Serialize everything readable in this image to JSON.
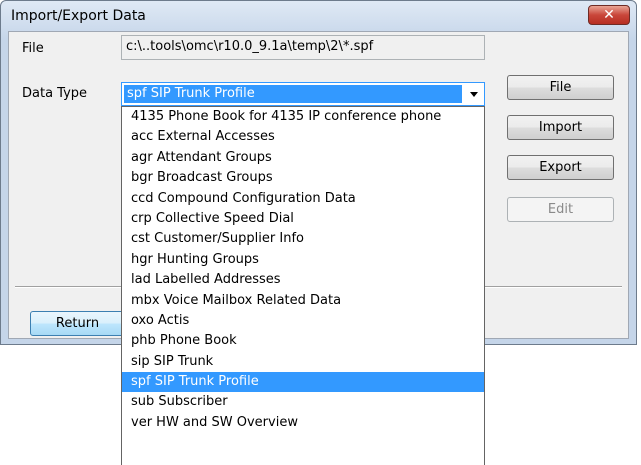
{
  "window": {
    "title": "Import/Export Data",
    "close_glyph": "✕"
  },
  "form": {
    "file_label": "File",
    "file_value": "c:\\..tools\\omc\\r10.0_9.1a\\temp\\2\\*.spf",
    "data_type_label": "Data Type",
    "data_type_value": "spf  SIP Trunk Profile"
  },
  "buttons": {
    "file": "File",
    "import": "Import",
    "export": "Export",
    "edit": "Edit",
    "return": "Return"
  },
  "dropdown": {
    "options": [
      "4135  Phone Book for 4135 IP conference phone",
      "acc  External Accesses",
      "agr  Attendant Groups",
      "bgr  Broadcast Groups",
      "ccd  Compound Configuration Data",
      "crp  Collective Speed Dial",
      "cst  Customer/Supplier Info",
      "hgr  Hunting Groups",
      "lad  Labelled Addresses",
      "mbx  Voice Mailbox Related Data",
      "oxo  Actis",
      "phb  Phone Book",
      "sip  SIP Trunk",
      "spf  SIP Trunk Profile",
      "sub  Subscriber",
      "ver  HW and SW Overview"
    ],
    "selected_index": 13
  }
}
